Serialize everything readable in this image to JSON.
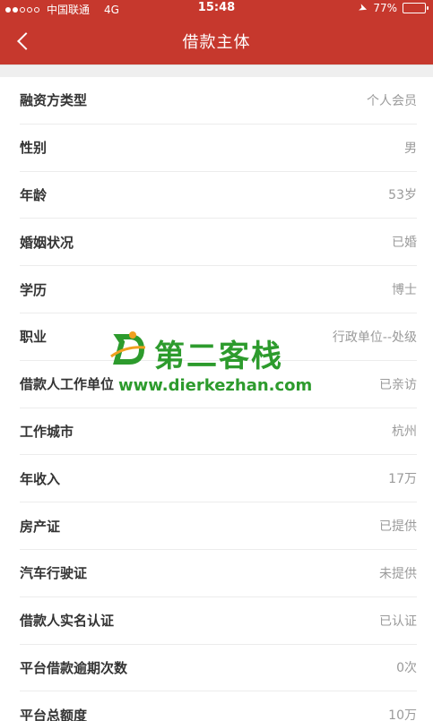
{
  "status_bar": {
    "carrier": "中国联通",
    "network": "4G",
    "time": "15:48",
    "battery": "77%",
    "battery_level": 0.77
  },
  "nav": {
    "title": "借款主体"
  },
  "rows": [
    {
      "label": "融资方类型",
      "value": "个人会员"
    },
    {
      "label": "性别",
      "value": "男"
    },
    {
      "label": "年龄",
      "value": "53岁"
    },
    {
      "label": "婚姻状况",
      "value": "已婚"
    },
    {
      "label": "学历",
      "value": "博士"
    },
    {
      "label": "职业",
      "value": "行政单位--处级"
    },
    {
      "label": "借款人工作单位",
      "value": "已亲访"
    },
    {
      "label": "工作城市",
      "value": "杭州"
    },
    {
      "label": "年收入",
      "value": "17万"
    },
    {
      "label": "房产证",
      "value": "已提供"
    },
    {
      "label": "汽车行驶证",
      "value": "未提供"
    },
    {
      "label": "借款人实名认证",
      "value": "已认证"
    },
    {
      "label": "平台借款逾期次数",
      "value": "0次"
    },
    {
      "label": "平台总额度",
      "value": "10万"
    }
  ],
  "watermark": {
    "brand": "第二客栈",
    "url": "www.dierkezhan.com"
  },
  "colors": {
    "header": "#c6382d",
    "watermark": "#2d9b2d"
  }
}
